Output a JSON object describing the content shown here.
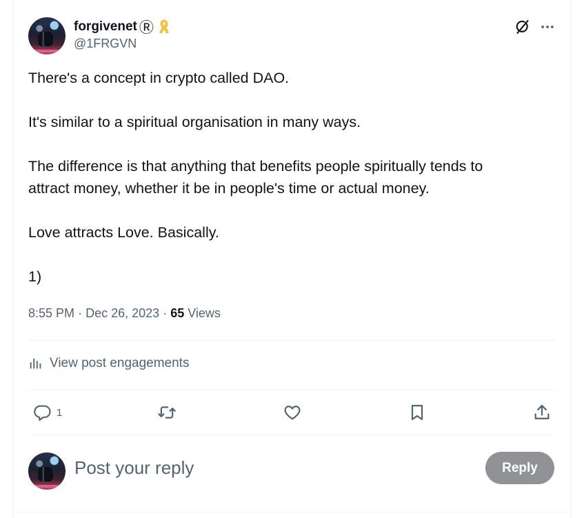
{
  "author": {
    "display_name": "forgivenet",
    "registered_mark": "Ⓡ",
    "badge_icon": "yellow-ribbon-icon",
    "handle": "@1FRGVN"
  },
  "header_actions": {
    "grok_icon": "grok-icon",
    "more_icon": "more-icon"
  },
  "tweet": {
    "paragraphs": [
      "There's a concept in crypto called DAO.",
      "It's similar to a spiritual organisation in many ways.",
      "The difference is that anything that benefits people spiritually tends to\nattract money, whether it be in people's time or actual money.",
      "Love attracts Love. Basically.",
      "1)"
    ],
    "time": "8:55 PM",
    "separator": "·",
    "date": "Dec 26, 2023",
    "views_count": "65",
    "views_label": "Views"
  },
  "engagements": {
    "label": "View post engagements"
  },
  "actions": {
    "reply_count": "1",
    "retweet_count": "",
    "like_count": "",
    "bookmark_count": ""
  },
  "composer": {
    "placeholder": "Post your reply",
    "reply_label": "Reply"
  },
  "colors": {
    "text": "#0f1419",
    "secondary": "#536471",
    "divider": "#eff3f4",
    "reply_button_disabled": "#8f9396",
    "ribbon": "#f7c843"
  }
}
